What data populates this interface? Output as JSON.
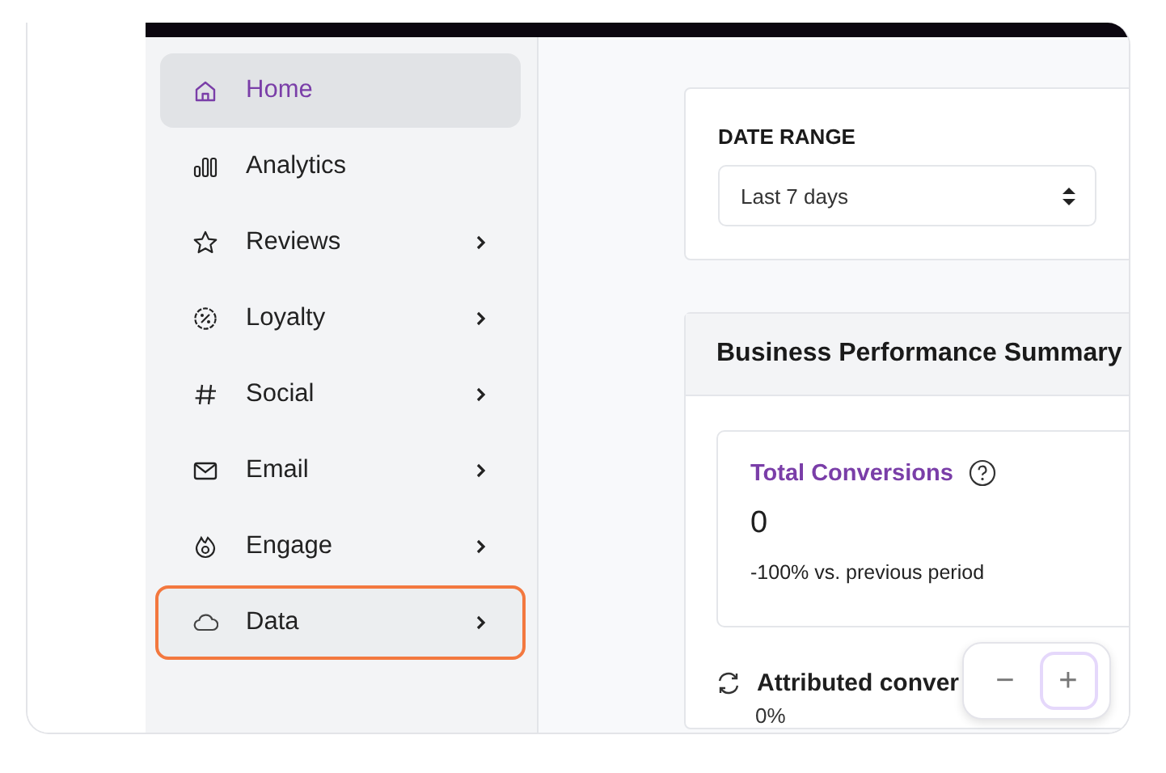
{
  "sidebar": {
    "items": [
      {
        "label": "Home",
        "selected": true,
        "highlighted": false,
        "expandable": false
      },
      {
        "label": "Analytics",
        "selected": false,
        "highlighted": false,
        "expandable": false
      },
      {
        "label": "Reviews",
        "selected": false,
        "highlighted": false,
        "expandable": true
      },
      {
        "label": "Loyalty",
        "selected": false,
        "highlighted": false,
        "expandable": true
      },
      {
        "label": "Social",
        "selected": false,
        "highlighted": false,
        "expandable": true
      },
      {
        "label": "Email",
        "selected": false,
        "highlighted": false,
        "expandable": true
      },
      {
        "label": "Engage",
        "selected": false,
        "highlighted": false,
        "expandable": true
      },
      {
        "label": "Data",
        "selected": false,
        "highlighted": true,
        "expandable": true
      }
    ]
  },
  "date_range": {
    "label": "DATE RANGE",
    "value": "Last 7 days"
  },
  "summary": {
    "title": "Business Performance Summary",
    "metric": {
      "title": "Total Conversions",
      "value": "0",
      "change": "-100% vs. previous period"
    },
    "attributed": {
      "title": "Attributed conver",
      "value": "0%"
    }
  },
  "zoom_controls": [
    {
      "label": "−",
      "focused": false
    },
    {
      "label": "+",
      "focused": true
    }
  ]
}
